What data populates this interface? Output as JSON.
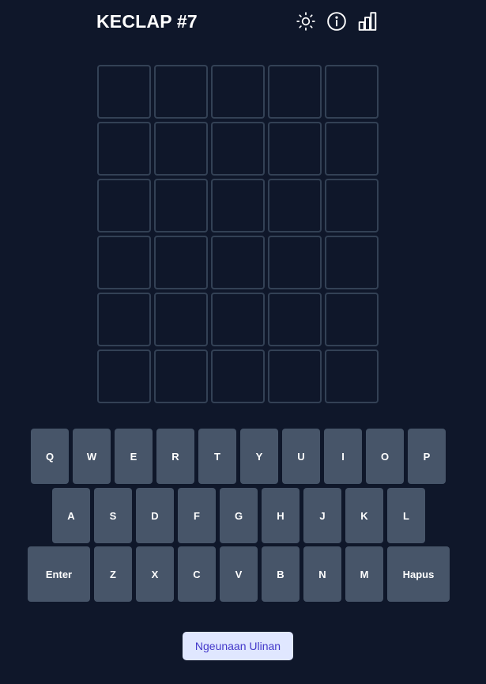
{
  "header": {
    "title": "KECLAP #7",
    "icons": [
      "sun-icon",
      "info-icon",
      "chart-bar-icon"
    ]
  },
  "board": {
    "rows": 6,
    "cols": 5,
    "letters": [
      [
        "",
        "",
        "",
        "",
        ""
      ],
      [
        "",
        "",
        "",
        "",
        ""
      ],
      [
        "",
        "",
        "",
        "",
        ""
      ],
      [
        "",
        "",
        "",
        "",
        ""
      ],
      [
        "",
        "",
        "",
        "",
        ""
      ],
      [
        "",
        "",
        "",
        "",
        ""
      ]
    ]
  },
  "keyboard": {
    "row1": [
      "Q",
      "W",
      "E",
      "R",
      "T",
      "Y",
      "U",
      "I",
      "O",
      "P"
    ],
    "row2": [
      "A",
      "S",
      "D",
      "F",
      "G",
      "H",
      "J",
      "K",
      "L"
    ],
    "row3": [
      "Enter",
      "Z",
      "X",
      "C",
      "V",
      "B",
      "N",
      "M",
      "Hapus"
    ]
  },
  "restart_button": {
    "label": "Ngeunaan Ulinan"
  },
  "colors": {
    "background": "#0f172a",
    "tile_border": "#334155",
    "key": "#475569",
    "button_bg": "#e0e7ff",
    "button_text": "#4338ca"
  }
}
